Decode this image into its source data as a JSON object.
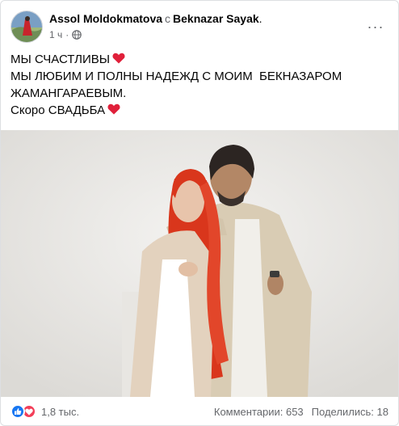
{
  "post": {
    "author": "Assol Moldokmatova",
    "with_word": "с",
    "tagged": "Beknazar Sayak",
    "name_suffix": ".",
    "time": "1 ч",
    "dot": "·",
    "audience_icon": "globe-icon",
    "more_icon": "more-options-icon",
    "more_label": "···",
    "text_lines": [
      "МЫ СЧАСТЛИВЫ",
      "МЫ ЛЮБИМ И ПОЛНЫ НАДЕЖД С МОИМ  БЕКНАЗАРОМ",
      "ЖАМАНГАРАЕВЫМ.",
      "Скоро СВАДЬБА"
    ],
    "heart_emoji": "red-heart-icon",
    "heart_color": "#e0203a"
  },
  "footer": {
    "reactions": [
      "like-icon",
      "love-icon"
    ],
    "reaction_count": "1,8 тыс.",
    "comments": "Комментарии: 653",
    "shares": "Поделились: 18"
  },
  "colors": {
    "like_blue": "#1877f2",
    "love_red": "#f33e58",
    "secondary_text": "#65676b",
    "hair_red": "#d9361c"
  }
}
